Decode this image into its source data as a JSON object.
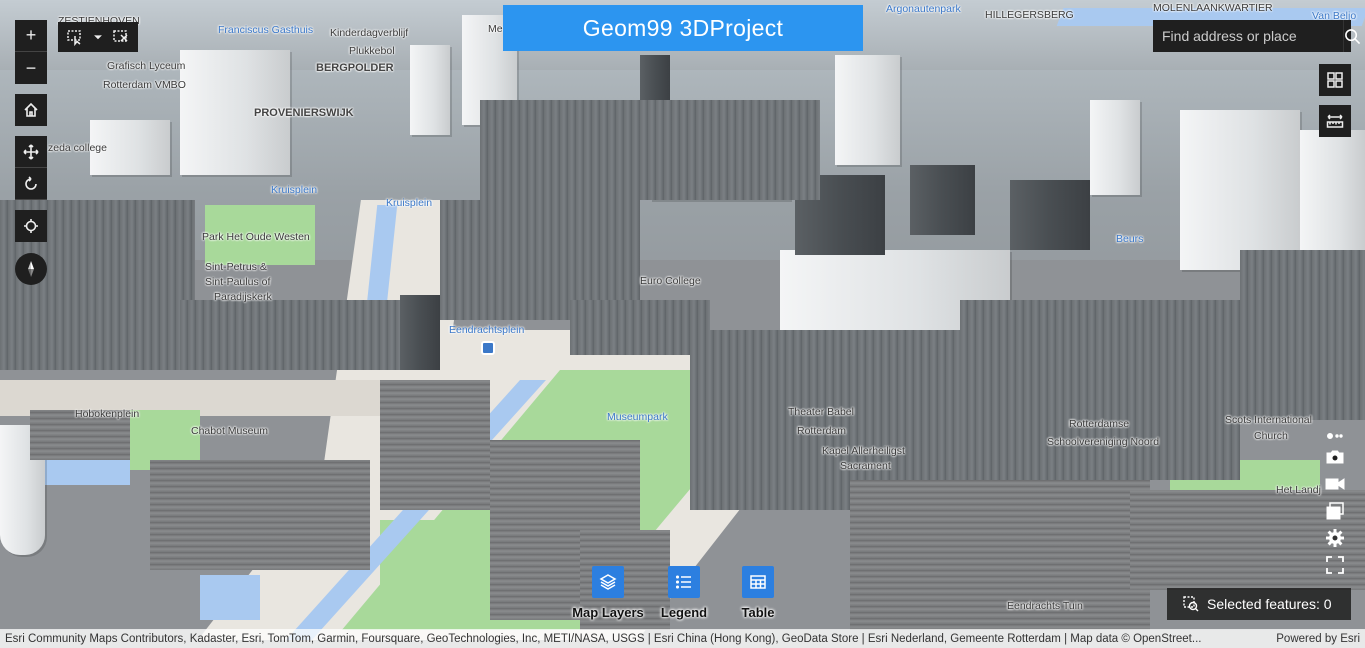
{
  "app": {
    "title": "Geom99 3DProject"
  },
  "search": {
    "placeholder": "Find address or place",
    "button_icon": "search-icon"
  },
  "navigation": {
    "zoom_in_label": "+",
    "zoom_out_label": "−",
    "home_icon": "home-icon",
    "pan_icon": "pan-icon",
    "rotate_icon": "rotate-icon",
    "locate_icon": "locate-icon",
    "compass_icon": "compass-icon",
    "select_icon": "select-lasso-icon",
    "dropdown_icon": "chevron-down-icon",
    "clear_selection_icon": "clear-selection-icon"
  },
  "right_tools": {
    "top": [
      "grid-icon",
      "measure-icon"
    ],
    "bottom": [
      "more-icon",
      "camera-icon",
      "video-icon",
      "layers-stack-icon",
      "gear-icon",
      "fullscreen-icon"
    ]
  },
  "widgets": [
    {
      "label": "Map Layers",
      "icon": "layers-icon"
    },
    {
      "label": "Legend",
      "icon": "legend-icon"
    },
    {
      "label": "Table",
      "icon": "table-icon"
    }
  ],
  "selection": {
    "label": "Selected features: 0"
  },
  "map_labels": {
    "zestienhoven": "ZESTIENHOVEN",
    "franciscus": "Franciscus Gasthuis",
    "kinderdagverblijf": "Kinderdagverblijf",
    "plukkebol": "Plukkebol",
    "bergpolder": "BERGPOLDER",
    "grafisch": "Grafisch Lyceum",
    "rotterdam_vmbo": "Rotterdam VMBO",
    "provenierswijk": "PROVENIERSWIJK",
    "zadkine": "zeda college",
    "kruisplein_a": "Kruisplein",
    "kruisplein_b": "Kruisplein",
    "park_oude_westen": "Park Het Oude Westen",
    "sint_petrus_1": "Sint-Petrus &",
    "sint_petrus_2": "Sint-Paulus of",
    "sint_petrus_3": "Paradijskerk",
    "euro_college": "Euro College",
    "eendrachtsplein": "Eendrachtsplein",
    "hobokenplein": "Hobokenplein",
    "chabot": "Chabot Museum",
    "museumpark": "Museumpark",
    "theater_babel_1": "Theater Babel",
    "theater_babel_2": "Rotterdam",
    "kapel_1": "Kapel Allerheiligst",
    "kapel_2": "Sacrament",
    "rotterdamse_1": "Rotterdamse",
    "rotterdamse_2": "Schoolvereniging Noord",
    "scots_1": "Scots International",
    "scots_2": "Church",
    "het_land": "Het Landj",
    "eendrachts_tuin": "Eendrachts Tuin",
    "beurs": "Beurs",
    "hillegersberg": "HILLEGERSBERG",
    "argonautenpark": "Argonautenpark",
    "molenlaankwartier": "MOLENLAANKWARTIER",
    "van_beljo": "Van Beljo",
    "me": "Me"
  },
  "colors": {
    "title_bg": "#2c95f0",
    "widget_bg": "#2c7fe0",
    "control_bg": "#1f1f1f",
    "park": "#a8d99a",
    "water": "#a9c9f0"
  },
  "attribution": {
    "text": "Esri Community Maps Contributors, Kadaster, Esri, TomTom, Garmin, Foursquare, GeoTechnologies, Inc, METI/NASA, USGS | Esri China (Hong Kong), GeoData Store | Esri Nederland, Gemeente Rotterdam | Map data © OpenStreet...",
    "powered_by": "Powered by Esri"
  }
}
